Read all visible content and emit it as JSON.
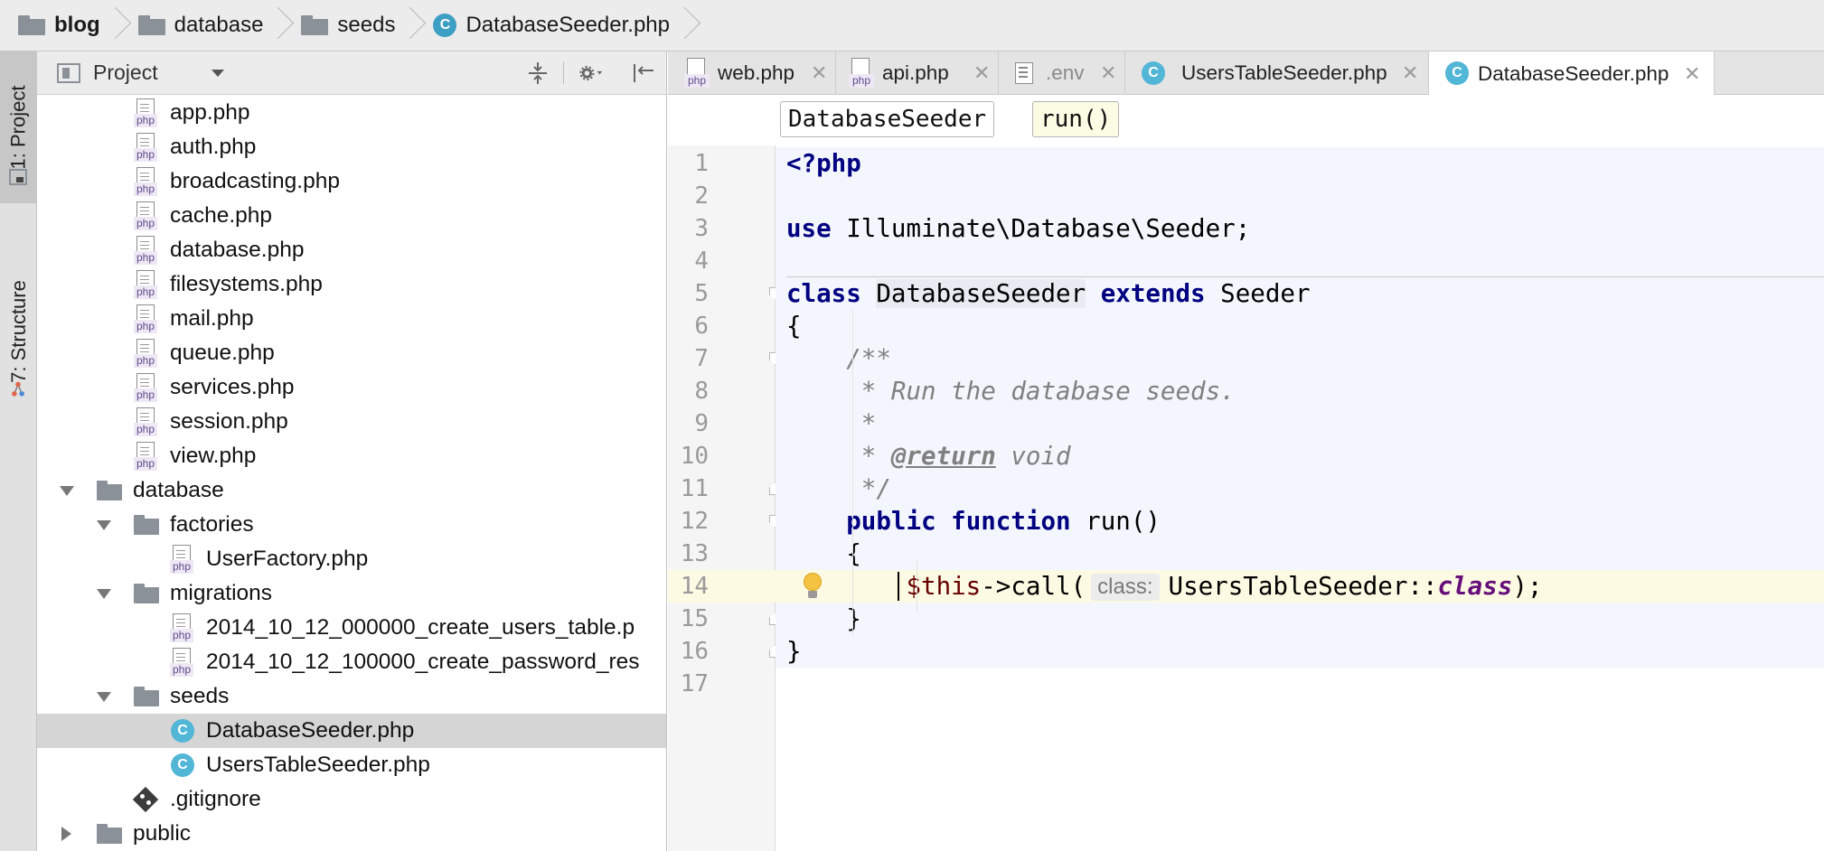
{
  "breadcrumb": {
    "items": [
      "blog",
      "database",
      "seeds",
      "DatabaseSeeder.php"
    ]
  },
  "toolstrip": {
    "project_tab": "1: Project",
    "structure_tab": "7: Structure"
  },
  "project_panel": {
    "title": "Project",
    "tree": [
      {
        "label": "app.php",
        "type": "php",
        "depth": 2
      },
      {
        "label": "auth.php",
        "type": "php",
        "depth": 2
      },
      {
        "label": "broadcasting.php",
        "type": "php",
        "depth": 2
      },
      {
        "label": "cache.php",
        "type": "php",
        "depth": 2
      },
      {
        "label": "database.php",
        "type": "php",
        "depth": 2
      },
      {
        "label": "filesystems.php",
        "type": "php",
        "depth": 2
      },
      {
        "label": "mail.php",
        "type": "php",
        "depth": 2
      },
      {
        "label": "queue.php",
        "type": "php",
        "depth": 2
      },
      {
        "label": "services.php",
        "type": "php",
        "depth": 2
      },
      {
        "label": "session.php",
        "type": "php",
        "depth": 2
      },
      {
        "label": "view.php",
        "type": "php",
        "depth": 2
      },
      {
        "label": "database",
        "type": "folder",
        "depth": 1,
        "expanded": true
      },
      {
        "label": "factories",
        "type": "folder",
        "depth": 2,
        "expanded": true
      },
      {
        "label": "UserFactory.php",
        "type": "php",
        "depth": 3
      },
      {
        "label": "migrations",
        "type": "folder",
        "depth": 2,
        "expanded": true
      },
      {
        "label": "2014_10_12_000000_create_users_table.p",
        "type": "php",
        "depth": 3
      },
      {
        "label": "2014_10_12_100000_create_password_res",
        "type": "php",
        "depth": 3
      },
      {
        "label": "seeds",
        "type": "folder",
        "depth": 2,
        "expanded": true
      },
      {
        "label": "DatabaseSeeder.php",
        "type": "class",
        "depth": 3,
        "selected": true
      },
      {
        "label": "UsersTableSeeder.php",
        "type": "class",
        "depth": 3
      },
      {
        "label": ".gitignore",
        "type": "git",
        "depth": 2
      },
      {
        "label": "public",
        "type": "folder",
        "depth": 1,
        "expanded": false
      }
    ]
  },
  "editor": {
    "tabs": [
      {
        "label": "web.php",
        "icon": "php"
      },
      {
        "label": "api.php",
        "icon": "php"
      },
      {
        "label": ".env",
        "icon": "text"
      },
      {
        "label": "UsersTableSeeder.php",
        "icon": "class"
      },
      {
        "label": "DatabaseSeeder.php",
        "icon": "class",
        "active": true
      }
    ],
    "nav": {
      "class": "DatabaseSeeder",
      "method": "run()"
    },
    "line_numbers": [
      "1",
      "2",
      "3",
      "4",
      "5",
      "6",
      "7",
      "8",
      "9",
      "10",
      "11",
      "12",
      "13",
      "14",
      "15",
      "16",
      "17"
    ],
    "code": {
      "l1": "<?php",
      "l3_kw": "use",
      "l3_rest": " Illuminate\\Database\\Seeder;",
      "l5_kw1": "class",
      "l5_name": "DatabaseSeeder",
      "l5_kw2": "extends",
      "l5_rest": " Seeder",
      "l6": "{",
      "l7": "    /**",
      "l8": "     * Run the database seeds.",
      "l9": "     *",
      "l10_pre": "     * ",
      "l10_tag": "@return",
      "l10_post": " void",
      "l11": "     */",
      "l12_kw1": "    public",
      "l12_kw2": "function",
      "l12_rest": " run()",
      "l13": "    {",
      "l14_var": "$this",
      "l14_call": "->call(",
      "l14_hint": "class:",
      "l14_arg": "UsersTableSeeder::",
      "l14_cls": "class",
      "l14_end": ");",
      "l15": "    }",
      "l16": "}"
    }
  },
  "colors": {
    "keyword": "#000080",
    "comment": "#808080",
    "variable": "#660000",
    "class_keyword": "#660e7a",
    "current_line": "#fcfae3",
    "selection": "#d5d5d5"
  }
}
